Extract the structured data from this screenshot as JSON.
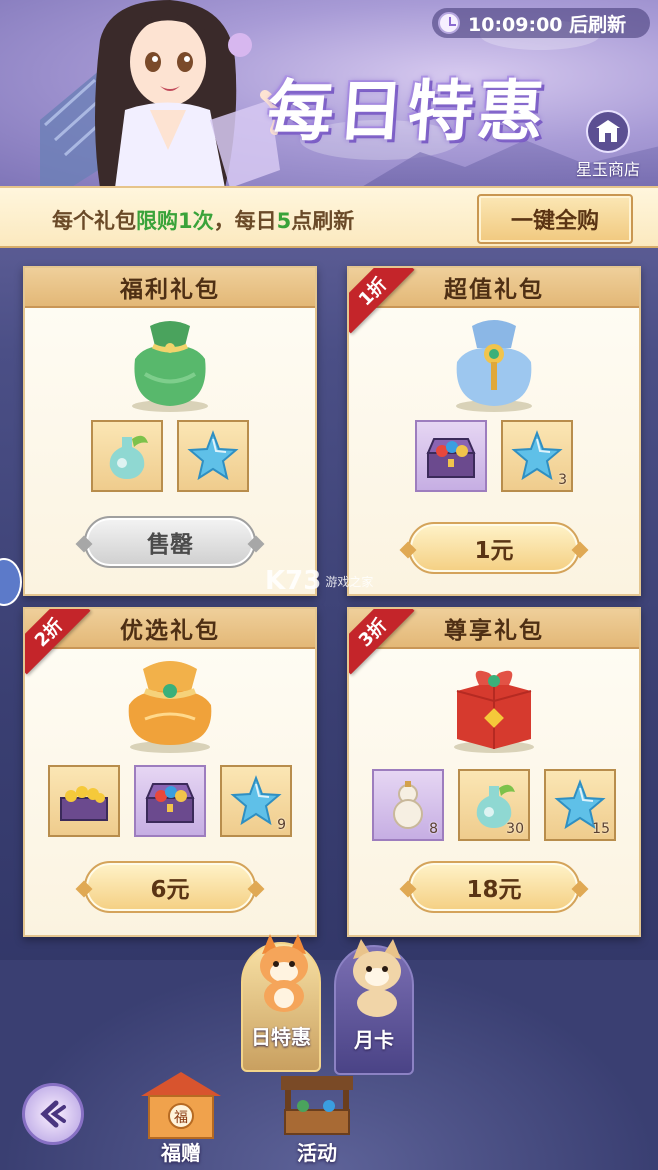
{
  "header": {
    "refresh_text": "10:09:00 后刷新",
    "title": "每日特惠",
    "shop_label": "星玉商店"
  },
  "info_bar": {
    "msg_part1": "每个礼包",
    "msg_hl1": "限购1次",
    "msg_part2": "，每日",
    "msg_hl2": "5",
    "msg_part3": "点刷新",
    "buy_all_label": "一键全购"
  },
  "packages": [
    {
      "title": "福利礼包",
      "discount": "",
      "price": "售罄",
      "sold_out": true,
      "items": [
        {
          "icon": "potion-icon",
          "count": ""
        },
        {
          "icon": "star-gem-icon",
          "count": ""
        }
      ]
    },
    {
      "title": "超值礼包",
      "discount": "1折",
      "price": "1元",
      "sold_out": false,
      "items": [
        {
          "icon": "treasure-chest-icon",
          "count": ""
        },
        {
          "icon": "star-gem-icon",
          "count": "3"
        }
      ]
    },
    {
      "title": "优选礼包",
      "discount": "2折",
      "price": "6元",
      "sold_out": false,
      "items": [
        {
          "icon": "gold-chest-icon",
          "count": ""
        },
        {
          "icon": "treasure-chest-icon",
          "count": ""
        },
        {
          "icon": "star-gem-icon",
          "count": "9"
        }
      ]
    },
    {
      "title": "尊享礼包",
      "discount": "3折",
      "price": "18元",
      "sold_out": false,
      "items": [
        {
          "icon": "gourd-icon",
          "count": "8"
        },
        {
          "icon": "potion-icon",
          "count": "30"
        },
        {
          "icon": "star-gem-icon",
          "count": "15"
        }
      ]
    }
  ],
  "tabs": [
    {
      "label": "日特惠",
      "active": true
    },
    {
      "label": "月卡",
      "active": false
    }
  ],
  "bottom_nav": [
    {
      "label": "福赠"
    },
    {
      "label": "活动"
    }
  ],
  "watermark": {
    "brand": "K73",
    "sub": "游戏之家"
  },
  "colors": {
    "accent_gold": "#e3b877",
    "discount_red": "#c4252a",
    "highlight_green": "#3aa33a",
    "banner_purple": "#a89bd6"
  }
}
